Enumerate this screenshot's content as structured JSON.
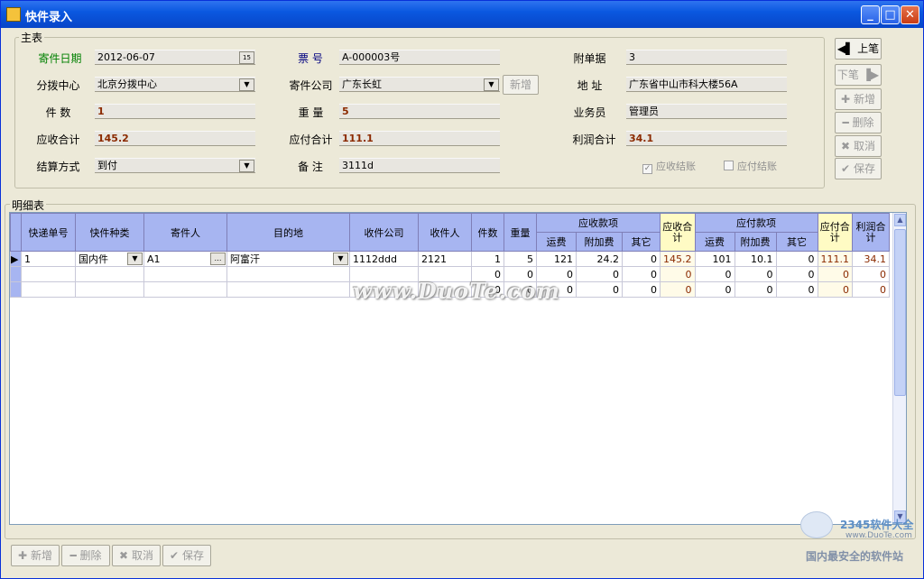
{
  "window": {
    "title": "快件录入"
  },
  "main_group": {
    "legend": "主表"
  },
  "detail_group": {
    "legend": "明细表"
  },
  "form": {
    "send_date_label": "寄件日期",
    "send_date_value": "2012-06-07",
    "ticket_label": "票 号",
    "ticket_value": "A-000003号",
    "attach_label": "附单据",
    "attach_value": "3",
    "hub_label": "分拨中心",
    "hub_value": "北京分拨中心",
    "company_label": "寄件公司",
    "company_value": "广东长虹",
    "company_add": "新增",
    "address_label": "地 址",
    "address_value": "广东省中山市科大楼56A",
    "pieces_label": "件 数",
    "pieces_value": "1",
    "weight_label": "重 量",
    "weight_value": "5",
    "salesman_label": "业务员",
    "salesman_value": "管理员",
    "receivable_label": "应收合计",
    "receivable_value": "145.2",
    "payable_label": "应付合计",
    "payable_value": "111.1",
    "profit_label": "利润合计",
    "profit_value": "34.1",
    "settle_label": "结算方式",
    "settle_value": "到付",
    "remark_label": "备 注",
    "remark_value": "3111d",
    "chk_receivable": "应收结账",
    "chk_payable": "应付结账"
  },
  "side_buttons": {
    "prev": "上笔",
    "next": "下笔",
    "add": "新增",
    "delete": "删除",
    "cancel": "取消",
    "save": "保存"
  },
  "bottom_buttons": {
    "add": "新增",
    "delete": "删除",
    "cancel": "取消",
    "save": "保存"
  },
  "grid": {
    "headers": {
      "tracking_no": "快递单号",
      "type": "快件种类",
      "sender": "寄件人",
      "dest": "目的地",
      "recv_company": "收件公司",
      "receiver": "收件人",
      "pieces": "件数",
      "weight": "重量",
      "recv_group": "应收款项",
      "recv_freight": "运费",
      "recv_extra": "附加费",
      "recv_other": "其它",
      "recv_total": "应收合计",
      "pay_group": "应付款项",
      "pay_freight": "运费",
      "pay_extra": "附加费",
      "pay_other": "其它",
      "pay_total": "应付合计",
      "profit_total": "利润合计"
    },
    "rows": [
      {
        "tracking_no": "1",
        "type": "国内件",
        "sender": "A1",
        "dest": "阿富汗",
        "recv_company": "1112ddd",
        "receiver": "2121",
        "pieces": "1",
        "weight": "5",
        "recv_freight": "121",
        "recv_extra": "24.2",
        "recv_other": "0",
        "recv_total": "145.2",
        "pay_freight": "101",
        "pay_extra": "10.1",
        "pay_other": "0",
        "pay_total": "111.1",
        "profit": "34.1"
      },
      {
        "tracking_no": "",
        "type": "",
        "sender": "",
        "dest": "",
        "recv_company": "",
        "receiver": "",
        "pieces": "0",
        "weight": "0",
        "recv_freight": "0",
        "recv_extra": "0",
        "recv_other": "0",
        "recv_total": "0",
        "pay_freight": "0",
        "pay_extra": "0",
        "pay_other": "0",
        "pay_total": "0",
        "profit": "0"
      },
      {
        "tracking_no": "",
        "type": "",
        "sender": "",
        "dest": "",
        "recv_company": "",
        "receiver": "",
        "pieces": "0",
        "weight": "0",
        "recv_freight": "0",
        "recv_extra": "0",
        "recv_other": "0",
        "recv_total": "0",
        "pay_freight": "0",
        "pay_extra": "0",
        "pay_other": "0",
        "pay_total": "0",
        "profit": "0"
      }
    ]
  },
  "watermark": {
    "text": "www.DuoTe.com",
    "logo_text": "2345软件大全",
    "logo_url": "www.DuoTe.com",
    "logo_slogan": "国内最安全的软件站"
  }
}
